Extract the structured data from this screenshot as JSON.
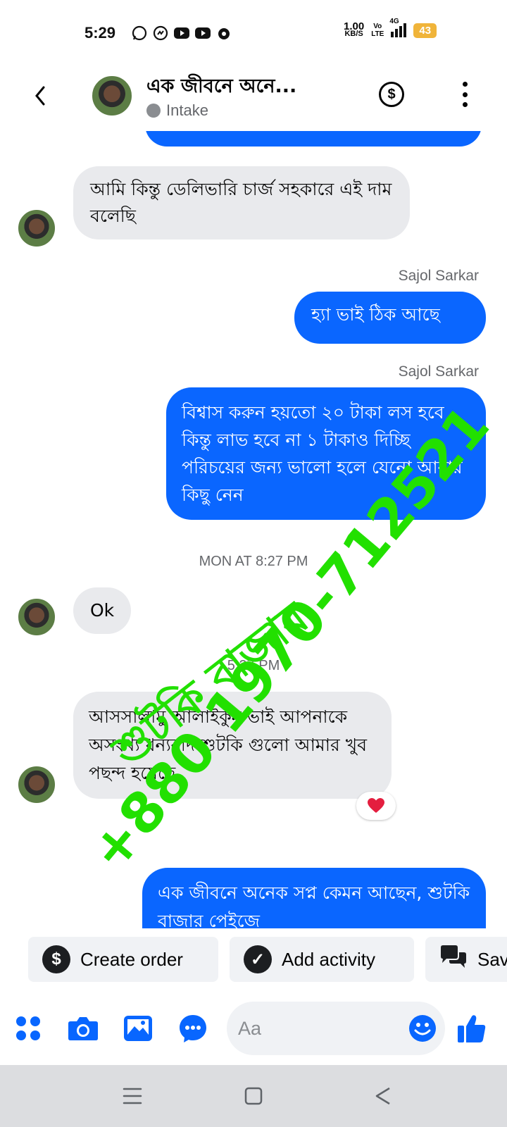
{
  "status_bar": {
    "time": "5:29",
    "speed_value": "1.00",
    "speed_unit": "KB/S",
    "volte_top": "Vo",
    "volte_bottom": "LTE",
    "network": "4G",
    "battery": "43"
  },
  "header": {
    "title": "এক জীবনে অনে...",
    "status": "Intake",
    "icons": [
      "back-chevron",
      "avatar",
      "dollar-circle",
      "more-vertical"
    ]
  },
  "messages": [
    {
      "type": "incoming",
      "text": "আমি কিন্তু ডেলিভারি চার্জ সহকারে এই দাম বলেছি"
    },
    {
      "type": "outgoing",
      "sender": "Sajol Sarkar",
      "text": "হ্যা ভাই ঠিক আছে"
    },
    {
      "type": "outgoing",
      "sender": "Sajol Sarkar",
      "text": "বিশ্বাস করুন হয়তো ২০ টাকা লস হবে কিন্তু লাভ হবে না ১ টাকাও দিচ্ছি পরিচয়ের জন্য ভালো হলে যেনো আবার কিছু নেন"
    },
    {
      "type": "timestamp",
      "text": "MON AT 8:27 PM"
    },
    {
      "type": "incoming",
      "text": "Ok"
    },
    {
      "type": "timestamp",
      "text": "5:27 PM"
    },
    {
      "type": "incoming",
      "text": "আসসালামু আলাইকুম ভাই আপনাকে অসংখ্য ধন্যবাদ শুটকি গুলো আমার খুব পছন্দ হয়েছে",
      "reaction": "heart"
    },
    {
      "type": "outgoing",
      "text": "এক জীবনে অনেক সপ্ন কেমন আছেন, শুটকি বাজার পেইজে"
    }
  ],
  "watermark": {
    "line1": "শুটকি বাজার",
    "line2": "+880 1970-712521"
  },
  "quick_actions": [
    {
      "label": "Create order",
      "icon": "dollar-icon"
    },
    {
      "label": "Add activity",
      "icon": "check-icon"
    },
    {
      "label": "Sav",
      "icon": "saved-replies-icon"
    }
  ],
  "composer": {
    "placeholder": "Aa",
    "icons": [
      "apps-icon",
      "camera-icon",
      "gallery-icon",
      "chat-bubble-icon",
      "emoji-icon",
      "thumbs-up-icon"
    ]
  },
  "colors": {
    "outgoing_bubble": "#0a66ff",
    "incoming_bubble": "#e9eaed",
    "accent": "#0866ff",
    "watermark": "#22e000",
    "battery": "#f0b43a"
  }
}
